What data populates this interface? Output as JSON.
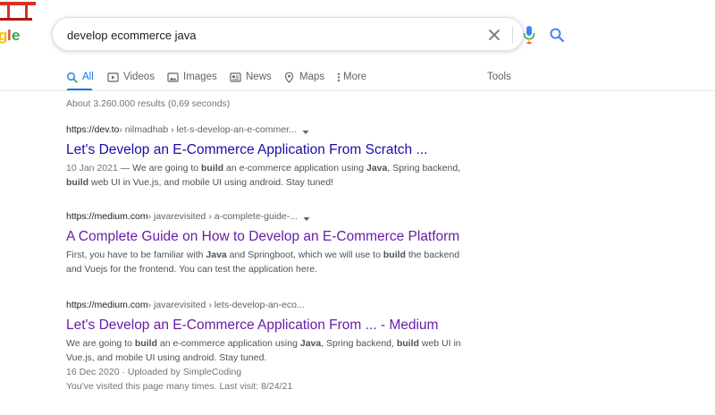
{
  "search": {
    "query": "develop ecommerce java",
    "icons": {
      "clear": "clear-x-icon",
      "voice": "microphone-icon",
      "submit": "search-icon"
    }
  },
  "tabs": [
    {
      "label": "All",
      "icon": "search-icon",
      "active": true
    },
    {
      "label": "Videos",
      "icon": "video-play-icon"
    },
    {
      "label": "Images",
      "icon": "image-icon"
    },
    {
      "label": "News",
      "icon": "newspaper-icon"
    },
    {
      "label": "Maps",
      "icon": "map-pin-icon"
    },
    {
      "label": "More",
      "icon": "more-vertical-icon"
    }
  ],
  "tools_label": "Tools",
  "stats": "About 3.260.000 results (0,69 seconds)",
  "results": [
    {
      "site": "https://dev.to",
      "path": " › nilmadhab › let-s-develop-an-e-commer...",
      "title": "Let's Develop an E-Commerce Application From Scratch ...",
      "date": "10 Jan 2021",
      "snippet_parts": [
        " — We are going to ",
        "build",
        " an e-commerce application using ",
        "Java",
        ", Spring backend, ",
        "build",
        " web UI in Vue.js, and mobile UI using android. Stay tuned!"
      ]
    },
    {
      "site": "https://medium.com",
      "path": " › javarevisited › a-complete-guide-...",
      "title": "A Complete Guide on How to Develop an E-Commerce Platform",
      "snippet_parts": [
        "First, you have to be familiar with ",
        "Java",
        " and Springboot, which we will use to ",
        "build",
        " the backend and Vuejs for the frontend. You can test the application here."
      ]
    },
    {
      "site": "https://medium.com",
      "path": " › javarevisited › lets-develop-an-eco...",
      "title": "Let's Develop an E-Commerce Application From ... - Medium",
      "snippet_parts": [
        "We are going to ",
        "build",
        " an e-commerce application using ",
        "Java",
        ", Spring backend, ",
        "build",
        " web UI in Vue.js, and mobile UI using android. Stay tuned."
      ],
      "uploaded": "16 Dec 2020 · Uploaded by SimpleCoding",
      "visited_note": "You've visited this page many times. Last visit: 8/24/21"
    }
  ],
  "colors": {
    "link_unvisited": "#1a0dab",
    "link_visited": "#681da8",
    "accent": "#1a73e8"
  }
}
